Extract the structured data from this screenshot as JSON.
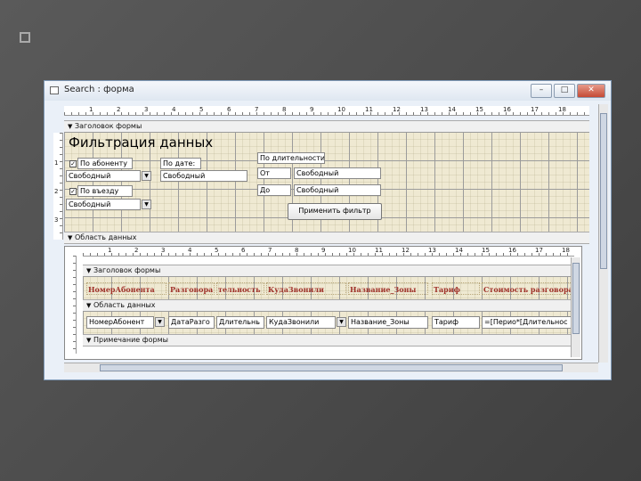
{
  "window": {
    "title": "Search : форма",
    "min": "–",
    "max": "□",
    "close": "✕"
  },
  "ruler_top": [
    "1",
    "2",
    "3",
    "4",
    "5",
    "6",
    "7",
    "8",
    "9",
    "10",
    "11",
    "12",
    "13",
    "14",
    "15",
    "16",
    "17",
    "18"
  ],
  "ruler_side": [
    "1",
    "2",
    "3"
  ],
  "sections": {
    "form_header": "Заголовок формы",
    "data_area": "Область данных",
    "sub_header": "Заголовок формы",
    "sub_data": "Область данных",
    "sub_note": "Примечание формы"
  },
  "header": {
    "title": "Фильтрация данных",
    "by_subscriber": "По абоненту",
    "by_date": "По дате:",
    "by_duration": "По длительности",
    "from_label": "От",
    "to_label": "До",
    "by_entrance": "По въезду",
    "combo1": "Свободный",
    "date_box": "Свободный",
    "from_box": "Свободный",
    "to_box": "Свободный",
    "combo2": "Свободный",
    "apply_button": "Применить фильтр"
  },
  "sub_headers": [
    "НомерАбонента",
    "Разговора",
    "тельность",
    "КудаЗвонили",
    "Название_Зоны",
    "Тариф",
    "Стоимость разговора"
  ],
  "sub_fields": [
    "НомерАбонент",
    "ДатаРазго",
    "Длительнь",
    "КудаЗвонили",
    "Название_Зоны",
    "Тариф",
    "=[Перио*[Длительнос"
  ]
}
